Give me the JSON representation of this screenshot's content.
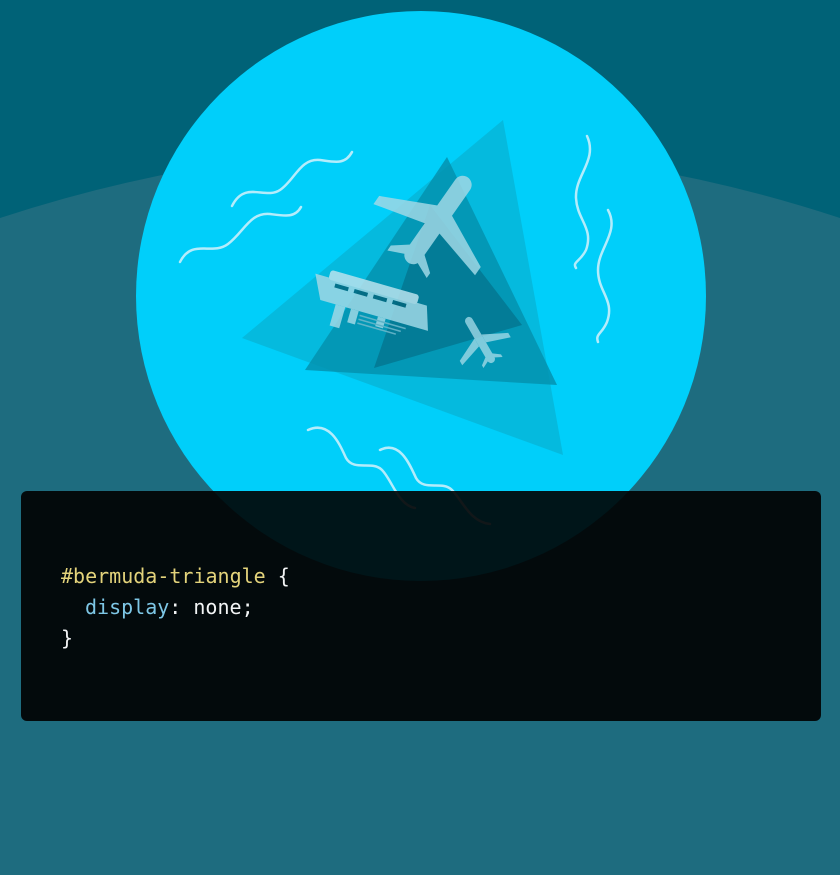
{
  "colors": {
    "background_top": "#006277",
    "background_bottom": "#1e6c7f",
    "circle": "#00cffa",
    "code_panel": "#000000",
    "selector": "#e3d37b",
    "property": "#7ec7e6",
    "text": "#f2f4f5"
  },
  "illustration": {
    "icons": [
      "airplane-icon",
      "ship-icon",
      "small-airplane-icon",
      "wave-icon"
    ]
  },
  "code": {
    "selector": "#bermuda-triangle",
    "open_brace": " {",
    "property": "display",
    "colon": ": ",
    "value": "none",
    "semicolon": ";",
    "close_brace": "}"
  }
}
